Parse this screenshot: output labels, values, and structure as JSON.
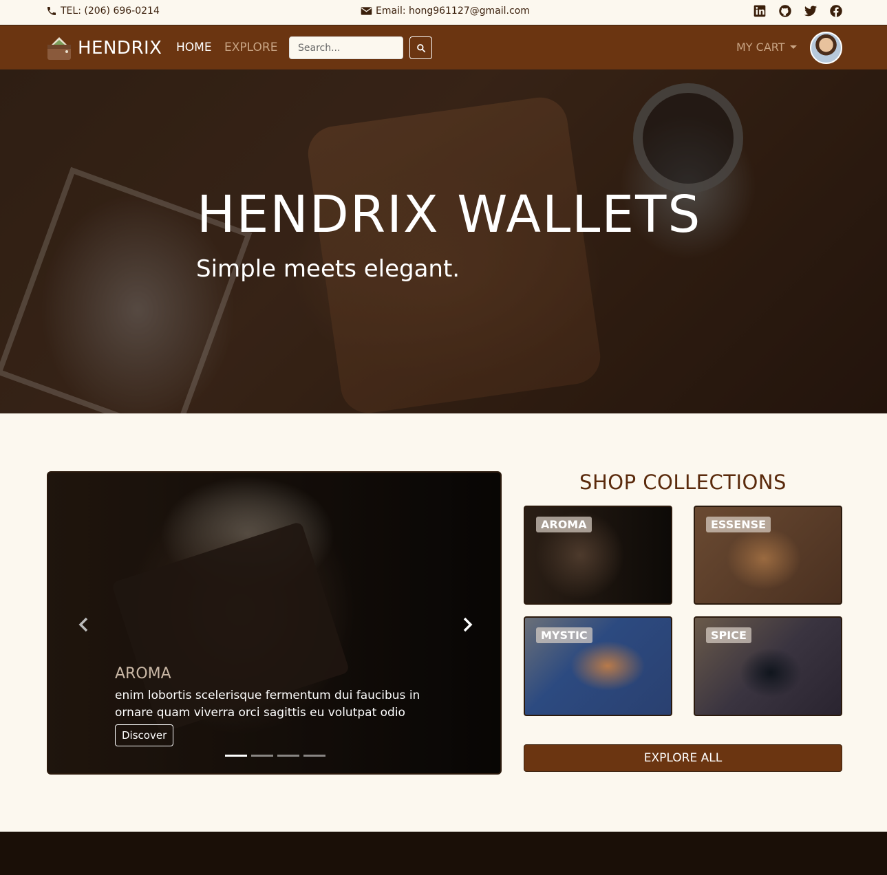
{
  "topbar": {
    "tel": "TEL: (206) 696-0214",
    "email": "Email: hong961127@gmail.com",
    "socials": [
      "linkedin-icon",
      "github-icon",
      "twitter-icon",
      "facebook-icon"
    ]
  },
  "navbar": {
    "brand": "HENDRIX",
    "home": "HOME",
    "explore": "EXPLORE",
    "search_placeholder": "Search...",
    "cart": "MY CART"
  },
  "hero": {
    "title": "HENDRIX WALLETS",
    "subtitle": "Simple meets elegant."
  },
  "carousel": {
    "caption_title": "AROMA",
    "caption_text": "enim lobortis scelerisque fermentum dui faucibus in ornare quam viverra orci sagittis eu volutpat odio",
    "button": "Discover",
    "slide_count": 4,
    "active_slide": 1
  },
  "collections": {
    "title": "SHOP COLLECTIONS",
    "items": [
      {
        "label": "AROMA"
      },
      {
        "label": "ESSENSE"
      },
      {
        "label": "MYSTIC"
      },
      {
        "label": "SPICE"
      }
    ],
    "explore_all": "EXPLORE ALL"
  },
  "colors": {
    "brand_brown": "#6b3511",
    "cream": "#fcf8ef",
    "dark_text": "#3a1f0b",
    "footer": "#1a0f07"
  }
}
